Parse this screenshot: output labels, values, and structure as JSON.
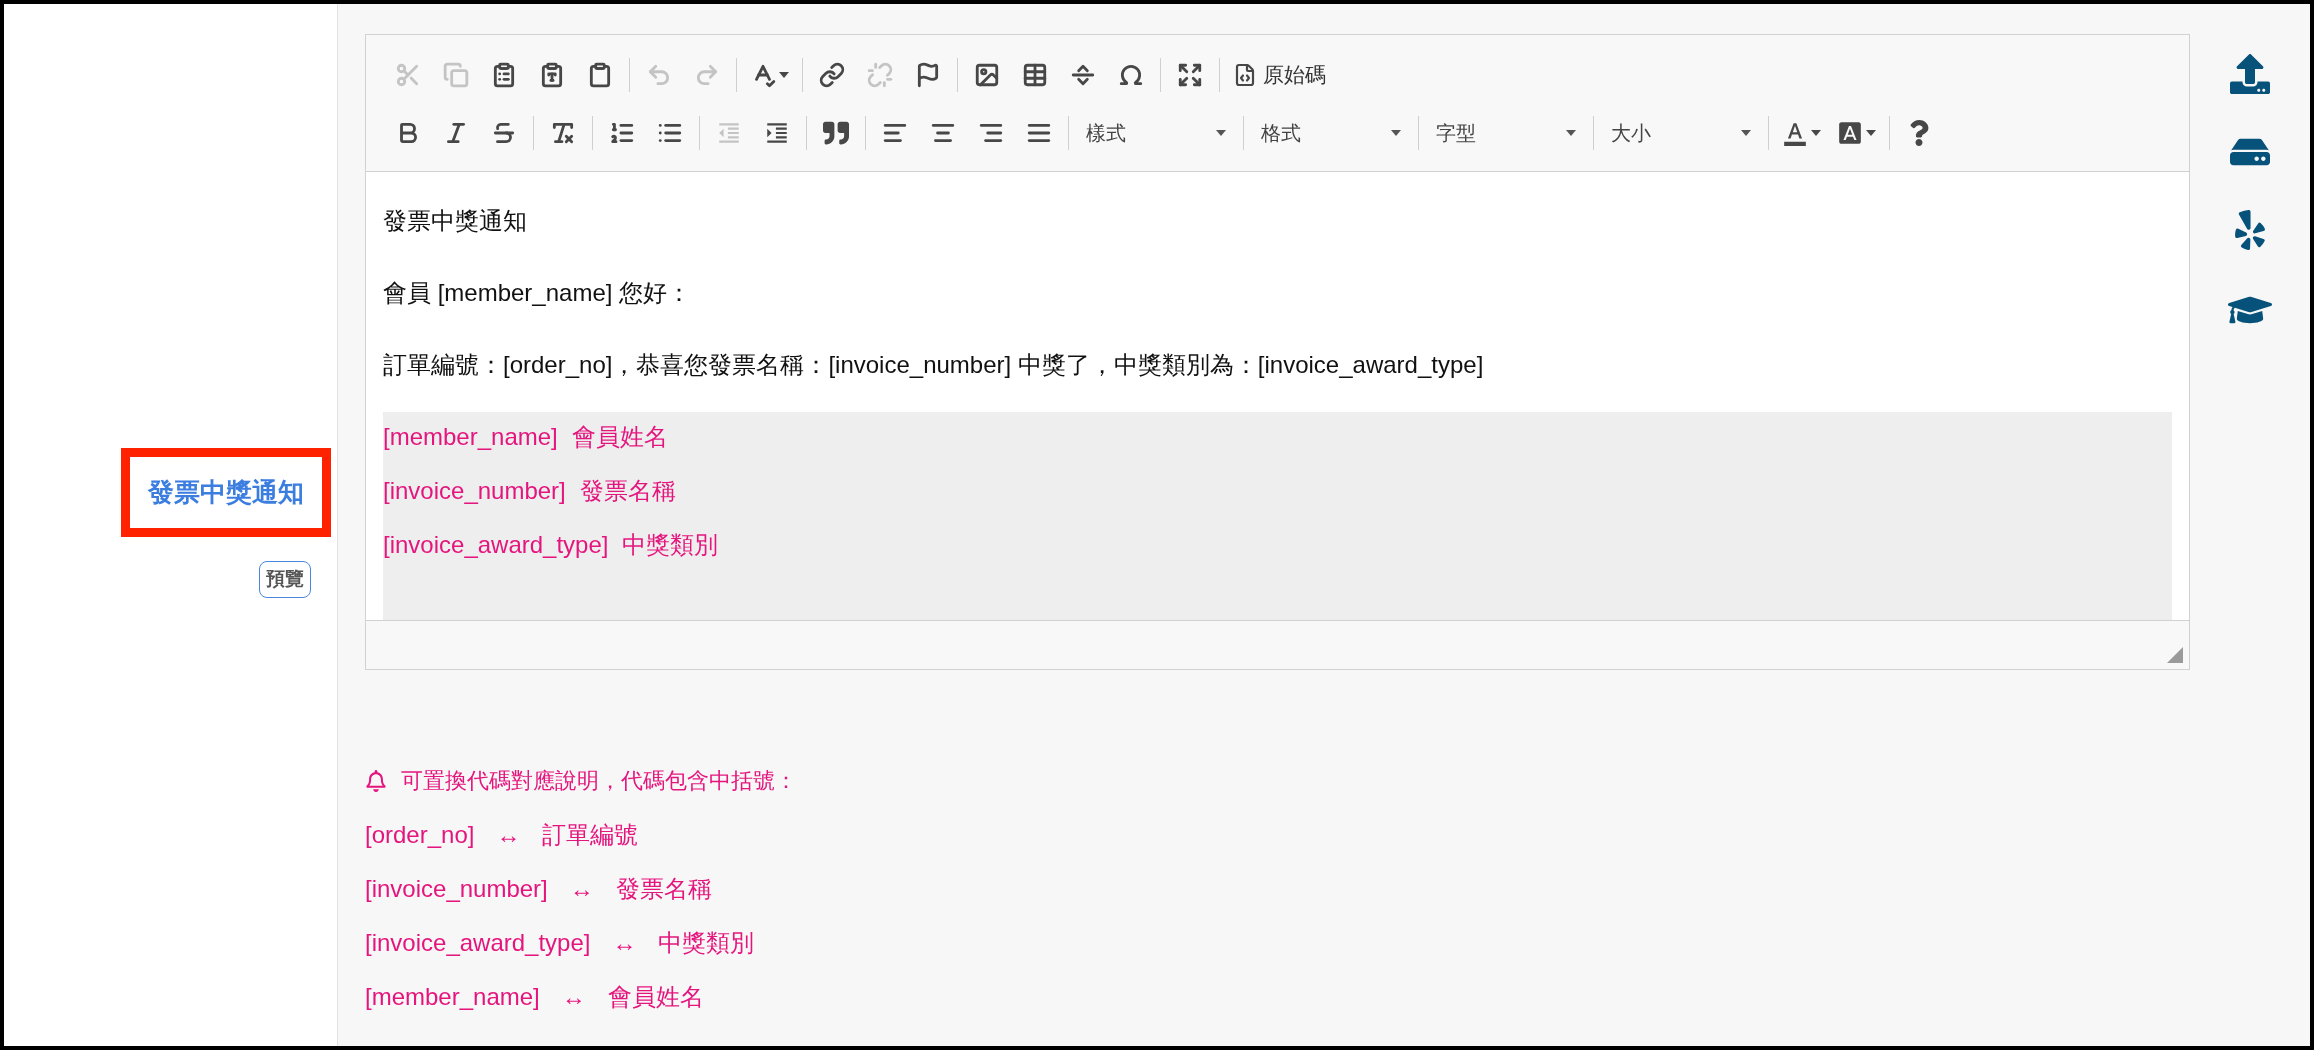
{
  "sidebar": {
    "template_title": "發票中獎通知",
    "preview_button": "預覽"
  },
  "editor": {
    "toolbar_rows": [
      {
        "groups": [
          {
            "items": [
              {
                "kind": "button",
                "disabled": true
              },
              {
                "kind": "button",
                "disabled": true
              },
              {
                "kind": "button",
                "disabled": false
              },
              {
                "kind": "button",
                "disabled": false
              },
              {
                "kind": "button",
                "disabled": false
              }
            ]
          },
          {
            "items": [
              {
                "kind": "button",
                "disabled": true
              },
              {
                "kind": "button",
                "disabled": true
              }
            ]
          },
          {
            "items": [
              {
                "kind": "button",
                "disabled": false
              }
            ]
          },
          {
            "items": [
              {
                "kind": "button",
                "disabled": false
              },
              {
                "kind": "button",
                "disabled": true
              },
              {
                "kind": "button",
                "disabled": false
              }
            ]
          },
          {
            "items": [
              {
                "kind": "button",
                "disabled": false
              },
              {
                "kind": "button",
                "disabled": false
              },
              {
                "kind": "button",
                "disabled": false
              },
              {
                "kind": "button",
                "disabled": false
              }
            ]
          },
          {
            "items": [
              {
                "kind": "button",
                "disabled": false
              }
            ]
          },
          {
            "items": [
              {
                "kind": "source",
                "label": "原始碼",
                "disabled": false
              }
            ]
          }
        ]
      },
      {
        "groups": [
          {
            "items": [
              {
                "kind": "button",
                "disabled": false
              },
              {
                "kind": "button",
                "disabled": false
              },
              {
                "kind": "button",
                "disabled": false
              }
            ]
          },
          {
            "items": [
              {
                "kind": "button",
                "disabled": false
              }
            ]
          },
          {
            "items": [
              {
                "kind": "button",
                "disabled": false
              },
              {
                "kind": "button",
                "disabled": false
              }
            ]
          },
          {
            "items": [
              {
                "kind": "button",
                "disabled": true
              },
              {
                "kind": "button",
                "disabled": false
              }
            ]
          },
          {
            "items": [
              {
                "kind": "button",
                "disabled": false
              }
            ]
          },
          {
            "items": [
              {
                "kind": "button",
                "disabled": false
              },
              {
                "kind": "button",
                "disabled": false
              },
              {
                "kind": "button",
                "disabled": false
              },
              {
                "kind": "button",
                "disabled": false
              }
            ]
          },
          {
            "items": [
              {
                "kind": "dropdown",
                "label": "樣式"
              }
            ]
          },
          {
            "items": [
              {
                "kind": "dropdown",
                "label": "格式"
              }
            ]
          },
          {
            "items": [
              {
                "kind": "dropdown",
                "label": "字型"
              }
            ]
          },
          {
            "items": [
              {
                "kind": "dropdown",
                "label": "大小"
              }
            ]
          },
          {
            "items": [
              {
                "kind": "button",
                "disabled": false
              },
              {
                "kind": "button",
                "disabled": false
              }
            ]
          },
          {
            "items": [
              {
                "kind": "button",
                "disabled": false
              }
            ]
          }
        ]
      }
    ],
    "paragraphs": [
      "發票中獎通知",
      "會員 [member_name] 您好：",
      "訂單編號：[order_no]，恭喜您發票名稱：[invoice_number] 中獎了，中獎類別為：[invoice_award_type]"
    ],
    "variable_rows": [
      {
        "code": "[member_name]",
        "meaning": "會員姓名"
      },
      {
        "code": "[invoice_number]",
        "meaning": "發票名稱"
      },
      {
        "code": "[invoice_award_type]",
        "meaning": "中獎類別"
      }
    ]
  },
  "notes": {
    "heading": "可置換代碼對應說明，代碼包含中括號：",
    "mappings": [
      {
        "code": "[order_no]",
        "arrow": "↔",
        "meaning": "訂單編號"
      },
      {
        "code": "[invoice_number]",
        "arrow": "↔",
        "meaning": "發票名稱"
      },
      {
        "code": "[invoice_award_type]",
        "arrow": "↔",
        "meaning": "中獎類別"
      },
      {
        "code": "[member_name]",
        "arrow": "↔",
        "meaning": "會員姓名"
      }
    ]
  }
}
